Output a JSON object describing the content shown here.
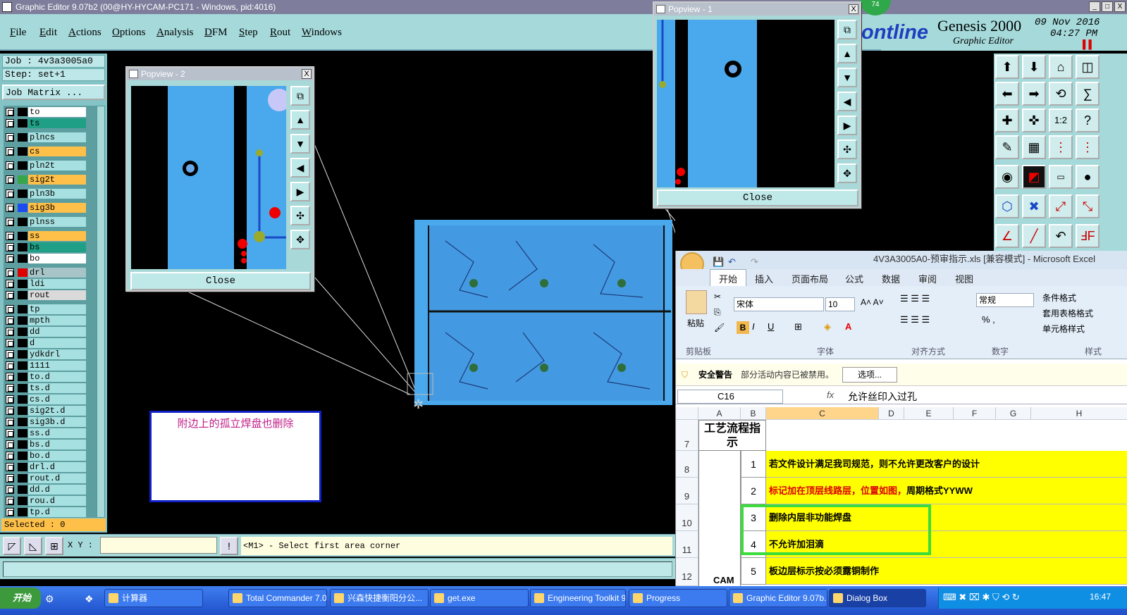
{
  "window": {
    "title": "Graphic Editor 9.07b2 (00@HY-HYCAM-PC171 - Windows, pid:4016)",
    "min": "_",
    "max": "□",
    "close": "X"
  },
  "menu": [
    "File",
    "Edit",
    "Actions",
    "Options",
    "Analysis",
    "DFM",
    "Step",
    "Rout",
    "Windows"
  ],
  "brand": {
    "logo": "ontline",
    "product": "Genesis 2000",
    "subtitle": "Graphic Editor",
    "date": "09 Nov 2016",
    "time": "04:27 PM",
    "badge": "74"
  },
  "job": {
    "job": "Job : 4v3a3005a0",
    "step": "Step: set+1",
    "matrix_button": "Job Matrix ..."
  },
  "layers": [
    {
      "name": "to",
      "color": "#ffffff",
      "swatch": "#000000"
    },
    {
      "name": "ts",
      "color": "#1f9f86",
      "swatch": "#000000"
    },
    {
      "name": "plncs",
      "color": "#a7e0e0",
      "swatch": "#000000"
    },
    {
      "name": "cs",
      "color": "#ffc04a",
      "swatch": "#000000"
    },
    {
      "name": "pln2t",
      "color": "#a7e0e0",
      "swatch": "#000000"
    },
    {
      "name": "sig2t",
      "color": "#ffc04a",
      "swatch": "#37a54a"
    },
    {
      "name": "pln3b",
      "color": "#a7e0e0",
      "swatch": "#000000"
    },
    {
      "name": "sig3b",
      "color": "#ffc04a",
      "swatch": "#1e4bf0"
    },
    {
      "name": "plnss",
      "color": "#a7e0e0",
      "swatch": "#000000"
    },
    {
      "name": "ss",
      "color": "#ffc04a",
      "swatch": "#000000"
    },
    {
      "name": "bs",
      "color": "#1f9f86",
      "swatch": "#000000"
    },
    {
      "name": "bo",
      "color": "#ffffff",
      "swatch": "#000000"
    },
    {
      "name": "drl",
      "color": "#a7c5c8",
      "swatch": "#e00000"
    },
    {
      "name": "ldi",
      "color": "#a7e0e0",
      "swatch": "#000000"
    },
    {
      "name": "rout",
      "color": "#dadada",
      "swatch": "#000000"
    },
    {
      "name": "tp",
      "color": "#a7e0e0",
      "swatch": "#000000"
    },
    {
      "name": "mpth",
      "color": "#a7e0e0",
      "swatch": "#000000"
    },
    {
      "name": "dd",
      "color": "#a7e0e0",
      "swatch": "#000000"
    },
    {
      "name": "d",
      "color": "#a7e0e0",
      "swatch": "#000000"
    },
    {
      "name": "ydkdrl",
      "color": "#a7e0e0",
      "swatch": "#000000"
    },
    {
      "name": "1111",
      "color": "#a7e0e0",
      "swatch": "#000000"
    },
    {
      "name": "to.d",
      "color": "#a7e0e0",
      "swatch": "#000000"
    },
    {
      "name": "ts.d",
      "color": "#a7e0e0",
      "swatch": "#000000"
    },
    {
      "name": "cs.d",
      "color": "#a7e0e0",
      "swatch": "#000000"
    },
    {
      "name": "sig2t.d",
      "color": "#a7e0e0",
      "swatch": "#000000"
    },
    {
      "name": "sig3b.d",
      "color": "#a7e0e0",
      "swatch": "#000000"
    },
    {
      "name": "ss.d",
      "color": "#a7e0e0",
      "swatch": "#000000"
    },
    {
      "name": "bs.d",
      "color": "#a7e0e0",
      "swatch": "#000000"
    },
    {
      "name": "bo.d",
      "color": "#a7e0e0",
      "swatch": "#000000"
    },
    {
      "name": "drl.d",
      "color": "#a7e0e0",
      "swatch": "#000000"
    },
    {
      "name": "rout.d",
      "color": "#a7e0e0",
      "swatch": "#000000"
    },
    {
      "name": "dd.d",
      "color": "#a7e0e0",
      "swatch": "#000000"
    },
    {
      "name": "rou.d",
      "color": "#a7e0e0",
      "swatch": "#000000"
    },
    {
      "name": "tp.d",
      "color": "#a7e0e0",
      "swatch": "#000000"
    }
  ],
  "selected": "Selected : 0",
  "cmd": {
    "xy_label": "X Y :",
    "xy_value": "",
    "message": "<M1> - Select first area corner",
    "warn": "!"
  },
  "popview2": {
    "title": "Popview - 2",
    "close": "Close",
    "x": "X"
  },
  "popview1": {
    "title": "Popview - 1",
    "close": "Close",
    "x": "X"
  },
  "note": "附边上的孤立焊盘也删除",
  "excel": {
    "title": "4V3A3005A0-预审指示.xls  [兼容模式] - Microsoft Excel",
    "tabs": [
      "开始",
      "插入",
      "页面布局",
      "公式",
      "数据",
      "审阅",
      "视图"
    ],
    "clipboard": "粘贴",
    "font_name": "宋体",
    "font_size": "10",
    "number_format": "常规",
    "styles": [
      "条件格式",
      "套用表格格式",
      "单元格样式"
    ],
    "groups": [
      "剪贴板",
      "字体",
      "对齐方式",
      "数字",
      "样式"
    ],
    "security": {
      "label": "安全警告",
      "text": "部分活动内容已被禁用。",
      "button": "选项..."
    },
    "namebox": "C16",
    "fx": "fx",
    "formula": "允许丝印入过孔",
    "columns": [
      "A",
      "B",
      "C",
      "D",
      "E",
      "F",
      "G",
      "H"
    ],
    "header_cell": "工艺流程指示",
    "rows": [
      {
        "row": "7",
        "num": "",
        "text": ""
      },
      {
        "row": "8",
        "num": "1",
        "text": "若文件设计满足我司规范，则不允许更改客户的设计"
      },
      {
        "row": "9",
        "num": "2",
        "text": "标记加在顶层线路层，位置如图，周期格式YYWW",
        "part_red": "标记加在顶层线路层，位置如图，"
      },
      {
        "row": "10",
        "num": "3",
        "text": "删除内层非功能焊盘"
      },
      {
        "row": "11",
        "num": "4",
        "text": "不允许加泪滴"
      },
      {
        "row": "12",
        "num": "5",
        "text": "板边层标示按必须露铜制作"
      }
    ],
    "cam": "CAM"
  },
  "taskbar": {
    "start": "开始",
    "tasks": [
      "计算器",
      "Total Commander 7.0...",
      "兴森快捷衡阳分公...",
      "get.exe",
      "Engineering Toolkit 9....",
      "Progress",
      "Graphic Editor 9.07b...",
      "Dialog Box"
    ],
    "clock": "16:47"
  }
}
